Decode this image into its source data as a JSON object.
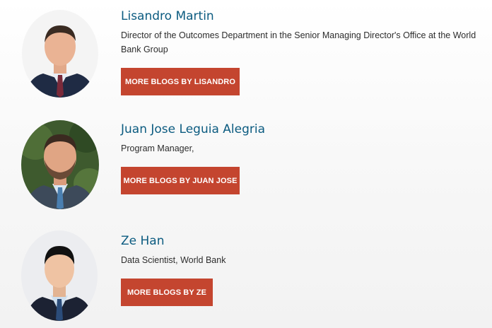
{
  "authors": [
    {
      "name": "Lisandro Martin",
      "title": "Director of the Outcomes Department in the Senior Managing Director's Office at the World Bank Group",
      "button_label": "MORE BLOGS BY LISANDRO"
    },
    {
      "name": "Juan Jose Leguia Alegria",
      "title": "Program Manager,",
      "button_label": "MORE BLOGS BY JUAN JOSE"
    },
    {
      "name": "Ze Han",
      "title": "Data Scientist, World Bank",
      "button_label": "MORE BLOGS BY ZE"
    }
  ],
  "colors": {
    "name_link": "#0b5b80",
    "button_bg": "#c4452f",
    "button_text": "#ffffff"
  }
}
